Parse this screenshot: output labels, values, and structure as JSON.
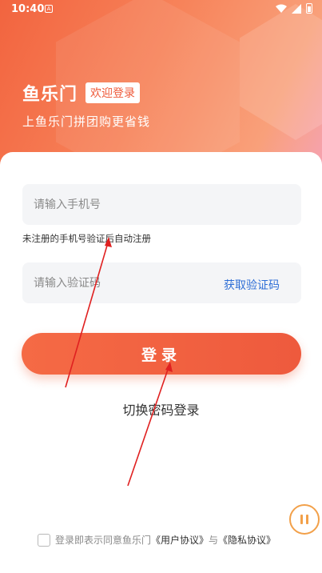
{
  "status_bar": {
    "time": "10:40",
    "notification_icon": "A"
  },
  "hero": {
    "brand": "鱼乐门",
    "welcome": "欢迎登录",
    "slogan": "上鱼乐门拼团购更省钱"
  },
  "form": {
    "phone_placeholder": "请输入手机号",
    "hint": "未注册的手机号验证后自动注册",
    "code_placeholder": "请输入验证码",
    "get_code_label": "获取验证码",
    "login_label": "登录",
    "switch_label": "切换密码登录"
  },
  "agreement": {
    "prefix": "登录即表示同意鱼乐门",
    "user_agreement": "《用户协议》",
    "and": "与",
    "privacy_policy": "《隐私协议》"
  },
  "colors": {
    "accent": "#ef5a3a",
    "link": "#2f6fd6",
    "annotation": "#e02020"
  }
}
